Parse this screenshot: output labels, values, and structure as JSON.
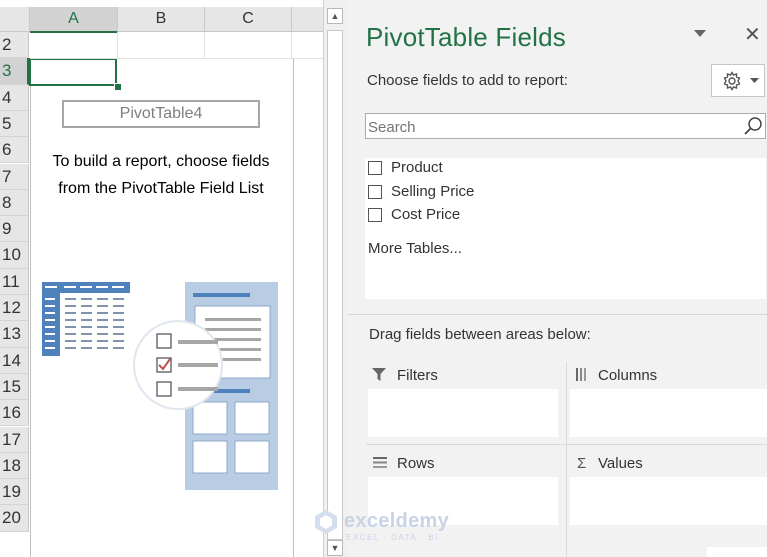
{
  "sheet": {
    "columns": [
      "A",
      "B",
      "C"
    ],
    "rows": [
      "2",
      "3",
      "4",
      "5",
      "6",
      "7",
      "8",
      "9",
      "10",
      "11",
      "12",
      "13",
      "14",
      "15",
      "16",
      "17",
      "18",
      "19",
      "20"
    ],
    "selected_column": "A",
    "selected_row": "3",
    "pivot_name": "PivotTable4",
    "pivot_help_line1": "To build a report, choose fields",
    "pivot_help_line2": "from the PivotTable Field List"
  },
  "pane": {
    "title": "PivotTable Fields",
    "menu_icon": "chevron-down-icon",
    "close_label": "✕",
    "choose_label": "Choose fields to add to report:",
    "tools_icon": "gear-icon",
    "search_placeholder": "Search",
    "fields": [
      {
        "label": "Product",
        "checked": false
      },
      {
        "label": "Selling Price",
        "checked": false
      },
      {
        "label": "Cost Price",
        "checked": false
      }
    ],
    "more_tables": "More Tables...",
    "drag_label": "Drag fields between areas below:",
    "areas": {
      "filters": "Filters",
      "columns": "Columns",
      "rows": "Rows",
      "values": "Values"
    }
  },
  "watermark": {
    "name": "exceldemy",
    "tagline": "EXCEL · DATA · BI"
  },
  "colors": {
    "accent": "#217346",
    "pane_bg": "#f2f2f2",
    "illustration_blue": "#4f81bd",
    "illustration_light": "#b8cce4",
    "check_red": "#c0504d"
  }
}
